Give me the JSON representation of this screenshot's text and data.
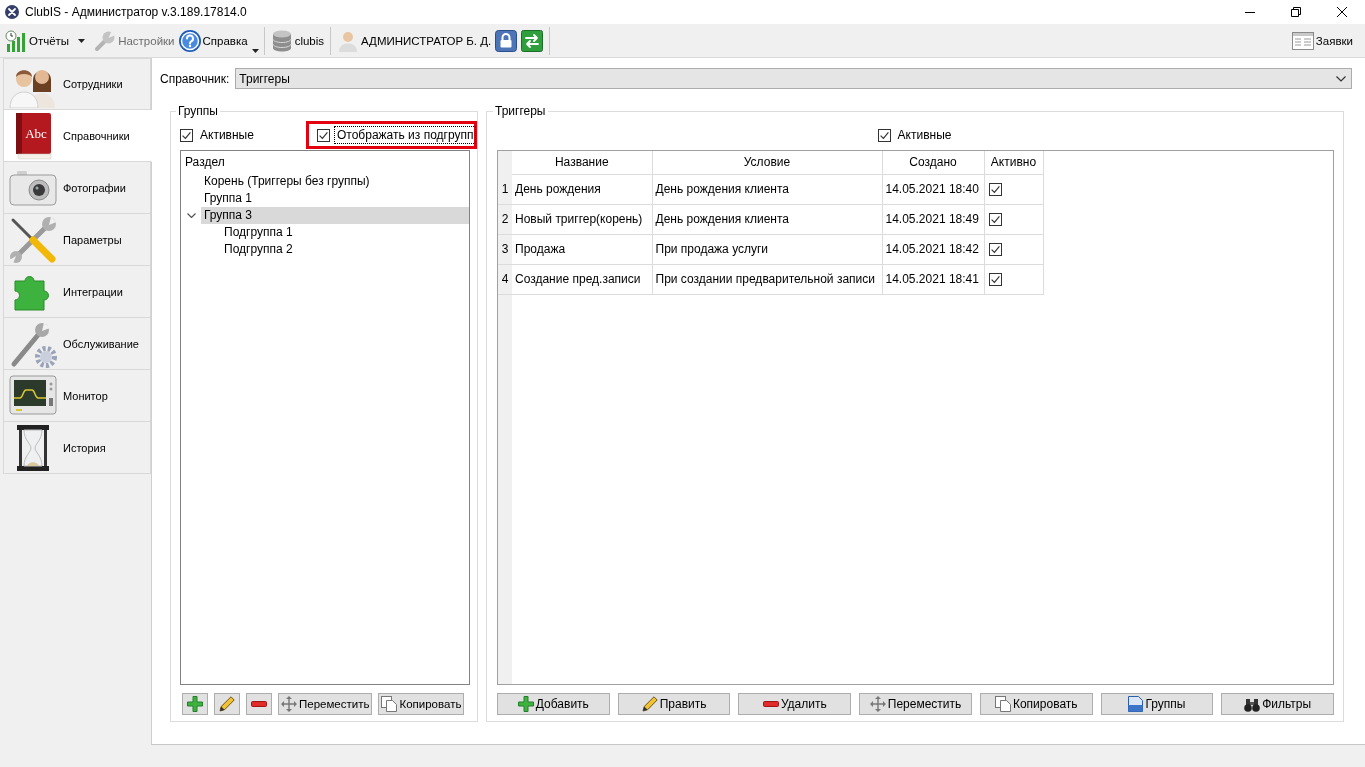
{
  "window": {
    "title": "ClubIS - Администратор v.3.189.17814.0"
  },
  "toolbar": {
    "groups": [
      [
        {
          "kind": "split",
          "label": "Отчёты",
          "disabled": false
        },
        {
          "kind": "button",
          "label": "Настройки",
          "disabled": true
        },
        {
          "kind": "menu",
          "label": "Справка",
          "disabled": false
        }
      ],
      [
        {
          "kind": "button",
          "label": "clubis",
          "disabled": false
        }
      ],
      [
        {
          "kind": "button",
          "label": "АДМИНИСТРАТОР Б. Д.",
          "disabled": false
        },
        {
          "kind": "icon",
          "disabled": false
        },
        {
          "kind": "icon",
          "disabled": false
        }
      ]
    ],
    "right": [
      {
        "kind": "button",
        "label": "Заявки",
        "disabled": false
      }
    ]
  },
  "sidebar": {
    "items": [
      {
        "label": "Сотрудники",
        "selected": false
      },
      {
        "label": "Справочники",
        "selected": true,
        "icon_text": "Abc"
      },
      {
        "label": "Фотографии",
        "selected": false
      },
      {
        "label": "Параметры",
        "selected": false
      },
      {
        "label": "Интеграции",
        "selected": false
      },
      {
        "label": "Обслуживание",
        "selected": false
      },
      {
        "label": "Монитор",
        "selected": false
      },
      {
        "label": "История",
        "selected": false
      }
    ]
  },
  "reference": {
    "label": "Справочник:",
    "value": "Триггеры"
  },
  "groups_panel": {
    "title": "Группы",
    "active_filter": {
      "label": "Активные",
      "checked": true
    },
    "subgroups_filter": {
      "label": "Отображать из подгрупп",
      "checked": true,
      "focused": true,
      "highlighted": true
    },
    "tree": {
      "header": "Раздел",
      "items": [
        {
          "label": "Корень (Триггеры без группы)",
          "selected": false
        },
        {
          "label": "Группа 1",
          "selected": false
        },
        {
          "label": "Группа 3",
          "selected": true,
          "expanded": true,
          "children": [
            {
              "label": "Подгруппа 1",
              "selected": false
            },
            {
              "label": "Подгруппа 2",
              "selected": false
            }
          ]
        }
      ]
    },
    "buttons": [
      {
        "kind": "add"
      },
      {
        "kind": "edit"
      },
      {
        "kind": "delete"
      },
      {
        "kind": "move",
        "label": "Переместить"
      },
      {
        "kind": "copy",
        "label": "Копировать"
      }
    ]
  },
  "triggers_panel": {
    "title": "Триггеры",
    "active_filter": {
      "label": "Активные",
      "checked": true
    },
    "table": {
      "columns": [
        "Название",
        "Условие",
        "Создано",
        "Активно"
      ],
      "rows": [
        {
          "number": "1",
          "name": "День рождения",
          "condition": "День рождения клиента",
          "created": "14.05.2021 18:40",
          "active": true
        },
        {
          "number": "2",
          "name": "Новый триггер(корень)",
          "condition": "День рождения клиента",
          "created": "14.05.2021 18:49",
          "active": true
        },
        {
          "number": "3",
          "name": "Продажа",
          "condition": "При продажа услуги",
          "created": "14.05.2021 18:42",
          "active": true
        },
        {
          "number": "4",
          "name": "Создание пред.записи",
          "condition": "При создании предварительной записи",
          "created": "14.05.2021 18:41",
          "active": true
        }
      ]
    },
    "buttons": [
      {
        "kind": "add",
        "label": "Добавить"
      },
      {
        "kind": "edit",
        "label": "Править"
      },
      {
        "kind": "delete",
        "label": "Удалить"
      },
      {
        "kind": "move",
        "label": "Переместить"
      },
      {
        "kind": "copy",
        "label": "Копировать"
      },
      {
        "kind": "groups",
        "label": "Группы"
      },
      {
        "kind": "filters",
        "label": "Фильтры"
      }
    ]
  }
}
